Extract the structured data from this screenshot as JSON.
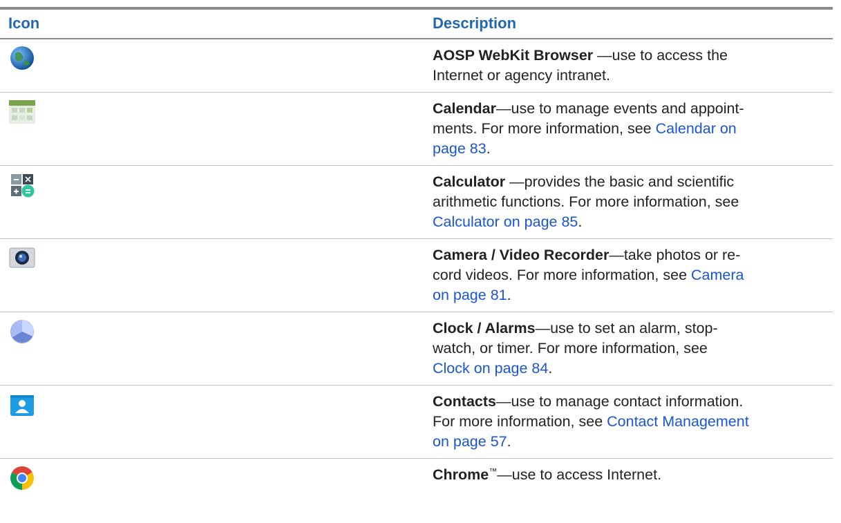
{
  "header": {
    "icon": "Icon",
    "description": "Description"
  },
  "rows": [
    {
      "icon": "globe-icon",
      "title": "AOSP WebKit Browser",
      "sep": " —",
      "lines": [
        "use to access the",
        "Internet or agency intranet."
      ],
      "link_lines": [],
      "tail": ""
    },
    {
      "icon": "calendar-icon",
      "title": "Calendar",
      "sep": "—",
      "lines": [
        "use to manage events and appoint-",
        "ments. For more information, see "
      ],
      "link_lines": [
        "Calendar on",
        "page 83"
      ],
      "tail": "."
    },
    {
      "icon": "calculator-icon",
      "title": "Calculator",
      "sep": " —",
      "lines": [
        "provides the basic and scientific",
        "arithmetic functions. For more information, see"
      ],
      "link_lines": [
        "Calculator on page 85"
      ],
      "tail": "."
    },
    {
      "icon": "camera-icon",
      "title": "Camera / Video Recorder",
      "sep": "—",
      "lines": [
        "take photos or re-",
        "cord videos. For more information, see "
      ],
      "link_lines": [
        "Camera",
        "on page 81"
      ],
      "tail": "."
    },
    {
      "icon": "clock-icon",
      "title": "Clock / Alarms",
      "sep": "—",
      "lines": [
        "use to set an alarm, stop-",
        "watch, or timer. For more information, see"
      ],
      "link_lines": [
        "Clock on page 84"
      ],
      "tail": "."
    },
    {
      "icon": "contacts-icon",
      "title": "Contacts",
      "sep": "—",
      "lines": [
        "use to manage contact information.",
        "For more information, see "
      ],
      "link_lines": [
        "Contact Management",
        "on page 57"
      ],
      "tail": "."
    },
    {
      "icon": "chrome-icon",
      "title": "Chrome",
      "sup": "™",
      "sep": "—",
      "lines": [
        "use to access Internet."
      ],
      "link_lines": [],
      "tail": ""
    }
  ],
  "colors": {
    "header_text": "#1f66b3",
    "link": "#1a55d4",
    "rule": "#8a8a8a"
  }
}
